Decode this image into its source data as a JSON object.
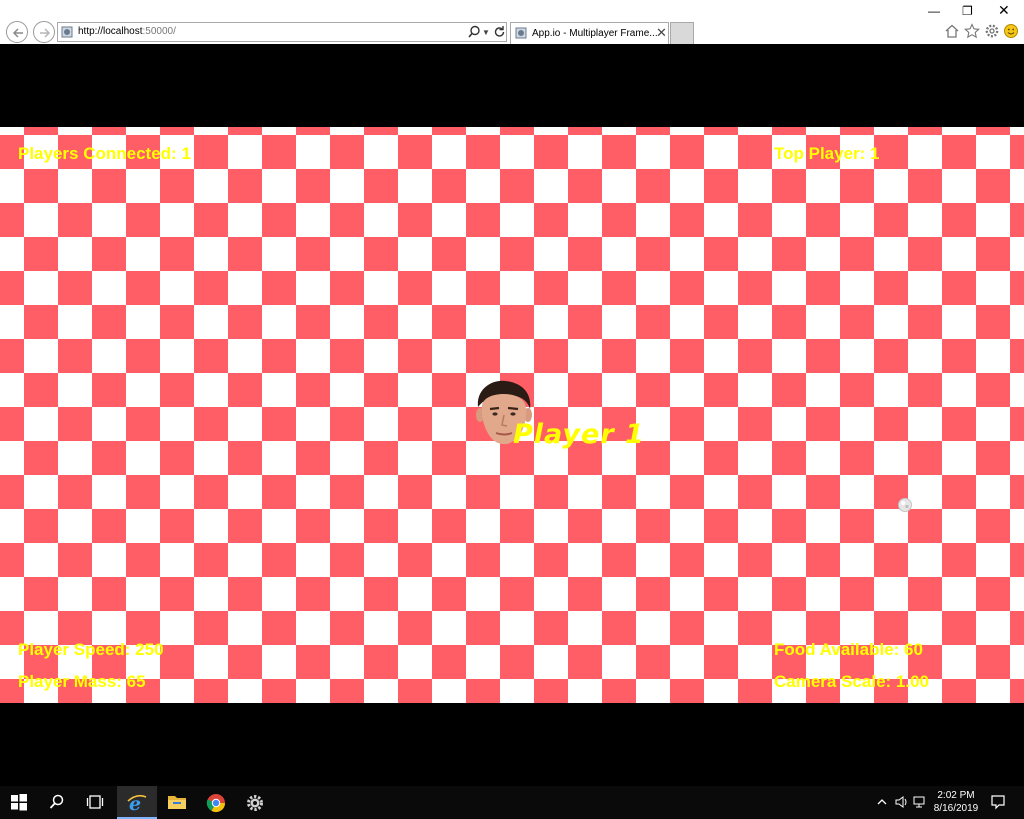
{
  "browser": {
    "address_host": "http://localhost",
    "address_port": ":50000/",
    "tab_title": "App.io - Multiplayer Frame...",
    "tab_close": "✕",
    "win_min": "—",
    "win_restore": "❐",
    "win_close": "✕",
    "icons": [
      "back-arrow-icon",
      "forward-arrow-icon",
      "page-icon",
      "search-icon",
      "refresh-icon",
      "home-icon",
      "star-icon",
      "gear-icon",
      "smiley-icon"
    ]
  },
  "game": {
    "players_connected": "Players Connected: 1",
    "top_player": "Top Player: 1",
    "player_speed": "Player Speed: 250",
    "player_mass": "Player Mass: 65",
    "food_available": "Food Available: 60",
    "camera_scale": "Camera Scale: 1.00",
    "player_name": "Player 1",
    "colors": {
      "checker": "#ff5e67",
      "hud_text": "#ffff00"
    }
  },
  "taskbar": {
    "time": "2:02 PM",
    "date": "8/16/2019",
    "icons": [
      "windows-start-icon",
      "search-icon",
      "task-view-icon",
      "internet-explorer-icon",
      "file-explorer-icon",
      "chrome-icon",
      "settings-gear-icon"
    ]
  }
}
